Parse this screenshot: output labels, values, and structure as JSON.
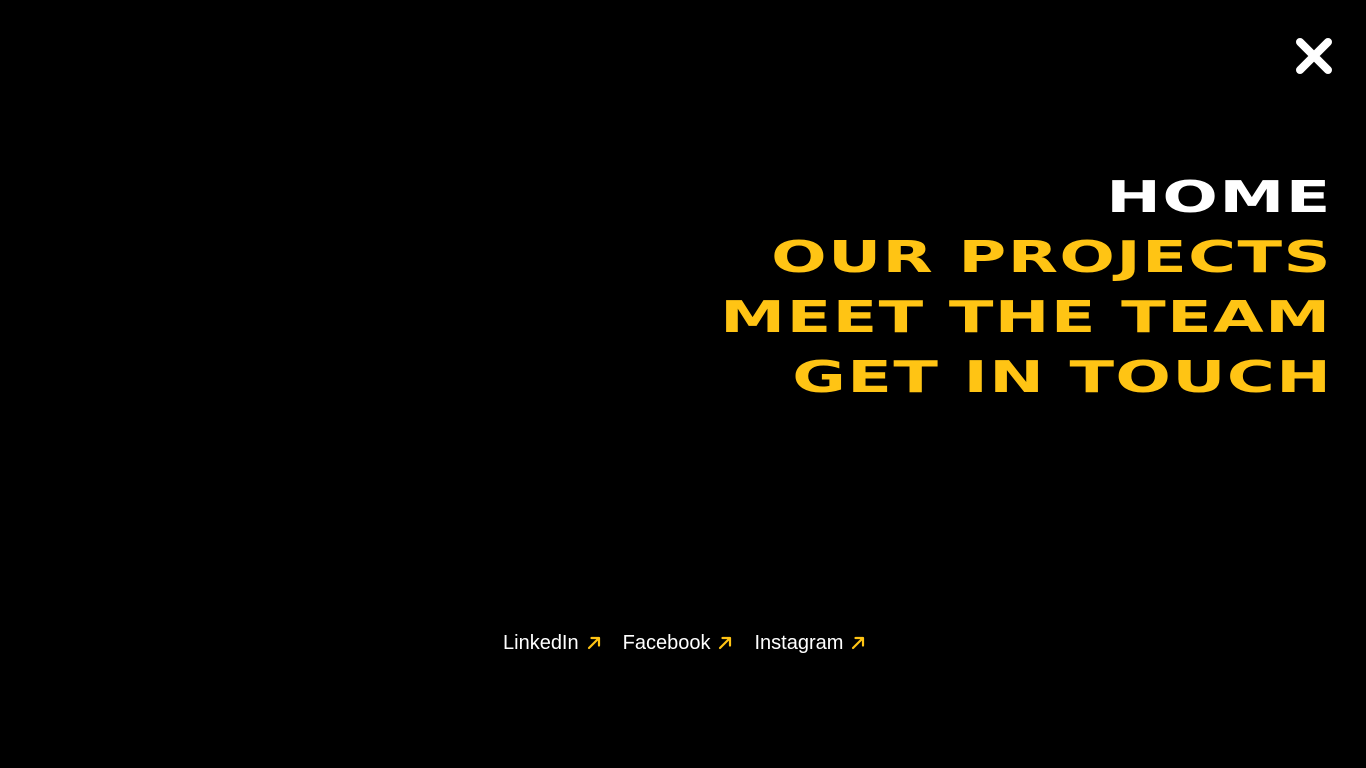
{
  "close": {
    "icon": "close-icon"
  },
  "nav": {
    "items": [
      {
        "label": "HOME",
        "active": true
      },
      {
        "label": "OUR PROJECTS",
        "active": false
      },
      {
        "label": "MEET THE TEAM",
        "active": false
      },
      {
        "label": "GET IN TOUCH",
        "active": false
      }
    ]
  },
  "social": {
    "links": [
      {
        "label": "LinkedIn",
        "icon": "external-arrow-icon"
      },
      {
        "label": "Facebook",
        "icon": "external-arrow-icon"
      },
      {
        "label": "Instagram",
        "icon": "external-arrow-icon"
      }
    ]
  },
  "colors": {
    "background": "#000000",
    "accent": "#ffc414",
    "active": "#ffffff"
  }
}
